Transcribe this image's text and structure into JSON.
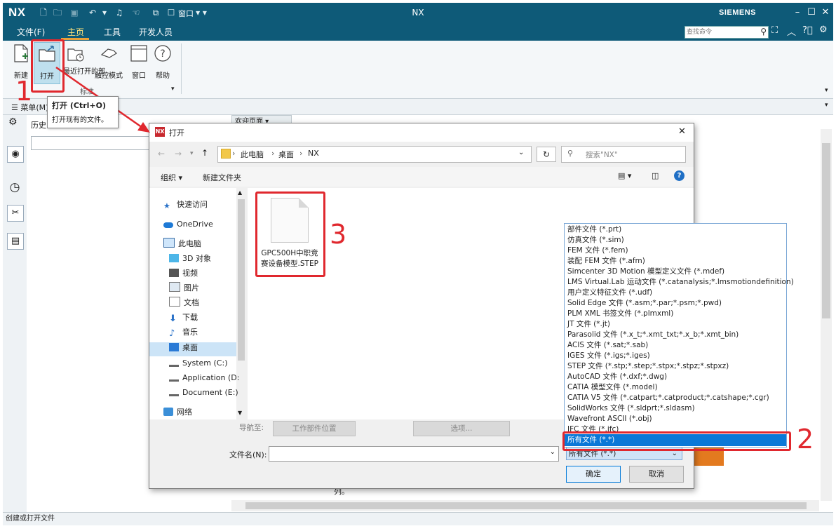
{
  "app": {
    "logo": "NX",
    "title": "NX",
    "brand": "SIEMENS",
    "window_menu_label": "窗口",
    "accent_color": "#0e5a78",
    "highlight_color": "#e0282e"
  },
  "menu_tabs": [
    "文件(F)",
    "主页",
    "工具",
    "开发人员"
  ],
  "search_placeholder": "查找命令",
  "ribbon": {
    "buttons": [
      "新建",
      "打开",
      "最近打开的部",
      "触控模式",
      "窗口",
      "帮助"
    ],
    "group_label": "标准"
  },
  "menu_row_label": "菜单(M)",
  "tooltip": {
    "title": "打开 (Ctrl+O)",
    "description": "打开现有的文件。"
  },
  "history_label": "历史",
  "welcome_tab": "欢迎页面",
  "status_text": "创建或打开文件",
  "background_text": "列。",
  "dialog": {
    "title": "打开",
    "close": "✕",
    "breadcrumb": [
      "此电脑",
      "桌面",
      "NX"
    ],
    "search_placeholder": "搜索\"NX\"",
    "organize": "组织 ▾",
    "new_folder": "新建文件夹",
    "nav_items": [
      "快速访问",
      "OneDrive",
      "此电脑",
      "3D 对象",
      "视频",
      "图片",
      "文档",
      "下载",
      "音乐",
      "桌面",
      "System (C:)",
      "Application (D:",
      "Document (E:)",
      "网络"
    ],
    "file": {
      "name": "GPC500H中职竞赛设备模型.STEP"
    },
    "nav_to_label": "导航至:",
    "work_part_location": "工作部件位置",
    "options": "选项...",
    "filename_label": "文件名(N):",
    "filename_value": "",
    "filetype_value": "所有文件 (*.*)",
    "ok": "确定",
    "cancel": "取消"
  },
  "file_types": [
    "部件文件 (*.prt)",
    "仿真文件 (*.sim)",
    "FEM 文件 (*.fem)",
    "装配 FEM 文件 (*.afm)",
    "Simcenter 3D Motion 模型定义文件 (*.mdef)",
    "LMS Virtual.Lab 运动文件 (*.catanalysis;*.lmsmotiondefinition)",
    "用户定义特征文件 (*.udf)",
    "Solid Edge 文件 (*.asm;*.par;*.psm;*.pwd)",
    "PLM XML 书签文件 (*.plmxml)",
    "JT 文件 (*.jt)",
    "Parasolid 文件 (*.x_t;*.xmt_txt;*.x_b;*.xmt_bin)",
    "ACIS 文件 (*.sat;*.sab)",
    "IGES 文件 (*.igs;*.iges)",
    "STEP 文件 (*.stp;*.step;*.stpx;*.stpz;*.stpxz)",
    "AutoCAD 文件 (*.dxf;*.dwg)",
    "CATIA 模型文件 (*.model)",
    "CATIA V5 文件  (*.catpart;*.catproduct;*.catshape;*.cgr)",
    "SolidWorks 文件 (*.sldprt;*.sldasm)",
    "Wavefront ASCII (*.obj)",
    "IFC 文件 (*.ifc)",
    "所有文件 (*.*)"
  ],
  "annotations": [
    "1",
    "2",
    "3"
  ]
}
